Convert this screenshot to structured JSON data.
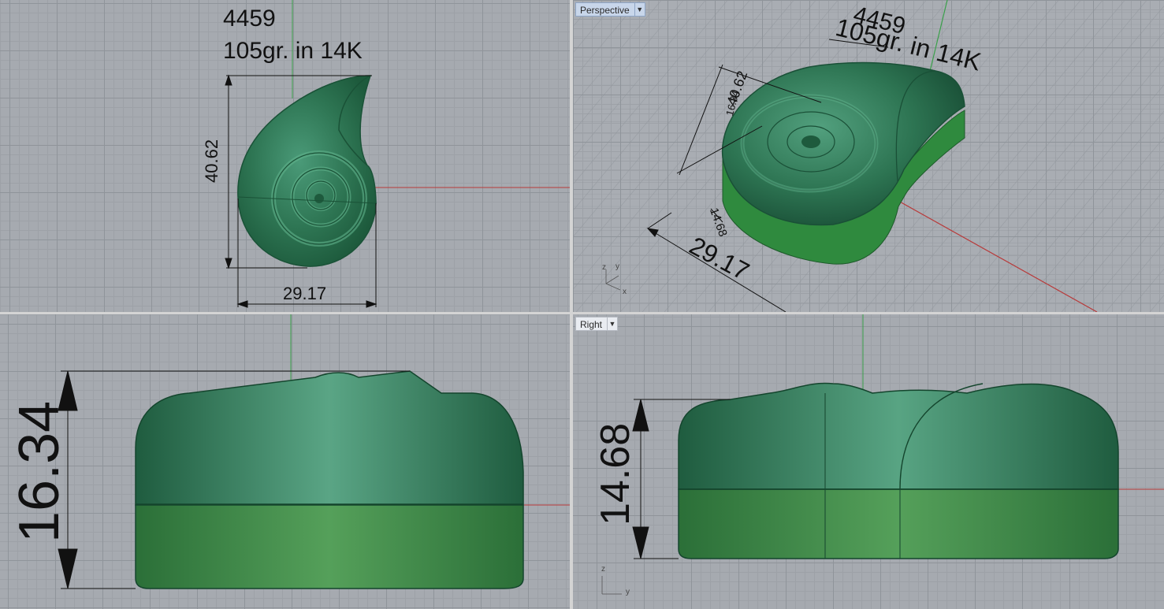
{
  "viewports": {
    "top": {
      "note_id": "4459",
      "note_weight": "105gr. in 14K",
      "dim_height": "40.62",
      "dim_width": "29.17"
    },
    "perspective": {
      "label": "Perspective",
      "note_id": "4459",
      "note_weight": "105gr. in 14K",
      "dim_height": "40.62",
      "dim_depth": "16.34",
      "dim_side": "14.68",
      "dim_width": "29.17",
      "axis_z": "z",
      "axis_y": "y",
      "axis_x": "x"
    },
    "front": {
      "dim_height": "16.34"
    },
    "right": {
      "label": "Right",
      "dim_height": "14.68",
      "axis_z": "z",
      "axis_y": "y"
    }
  },
  "colors": {
    "grid_bg": "#a6aab0",
    "model_green": "#2f7a55",
    "model_base_green": "#3f8f45",
    "x_axis": "#b83a3a",
    "y_axis": "#3aa04a"
  },
  "icons": {
    "dropdown": "chevron-down-icon"
  }
}
